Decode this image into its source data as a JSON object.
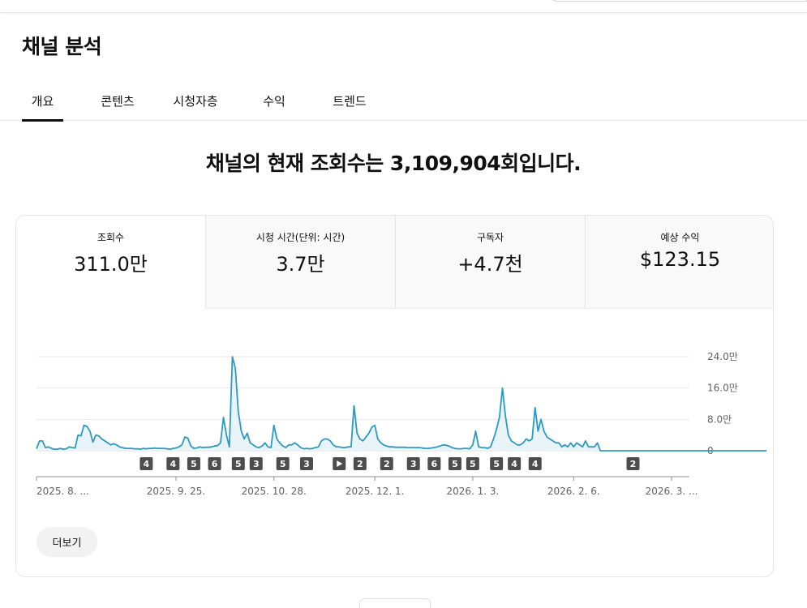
{
  "page": {
    "title": "채널 분석",
    "headline": "채널의 현재 조회수는 3,109,904회입니다.",
    "more_label": "더보기"
  },
  "tabs": [
    {
      "label": "개요",
      "active": true
    },
    {
      "label": "콘텐츠"
    },
    {
      "label": "시청자층"
    },
    {
      "label": "수익"
    },
    {
      "label": "트렌드"
    }
  ],
  "metrics": [
    {
      "label": "조회수",
      "value": "311.0만",
      "active": true
    },
    {
      "label": "시청 시간(단위: 시간)",
      "value": "3.7만"
    },
    {
      "label": "구독자",
      "value": "+4.7천"
    },
    {
      "label": "예상 수익",
      "value": "$123.15"
    }
  ],
  "colors": {
    "accent": "#2e9abf",
    "area_fill": "#e8f4f8",
    "marker_bg": "#4d4d4d"
  },
  "chart_data": {
    "type": "area",
    "series_unit": "views (만)",
    "ylim": [
      0,
      24
    ],
    "y_ticks": [
      {
        "value": 24,
        "label": "24.0만"
      },
      {
        "value": 16,
        "label": "16.0만"
      },
      {
        "value": 8,
        "label": "8.0만"
      },
      {
        "value": 0,
        "label": "0"
      }
    ],
    "x_tick_labels": [
      "2025. 8. ...",
      "2025. 9. 25.",
      "2025. 10. 28.",
      "2025. 12. 1.",
      "2026. 1. 3.",
      "2026. 2. 6.",
      "2026. 3. ..."
    ],
    "x_tick_days": [
      0,
      47,
      80,
      114,
      147,
      181,
      214
    ],
    "day_range": [
      0,
      220
    ],
    "values": [
      0.5,
      2.5,
      2.5,
      0.8,
      1.0,
      0.6,
      0.4,
      0.4,
      0.6,
      0.4,
      0.5,
      1.0,
      0.8,
      0.7,
      4.0,
      3.8,
      6.5,
      6.2,
      5.0,
      2.2,
      4.0,
      3.8,
      3.0,
      2.5,
      2.0,
      1.5,
      1.8,
      1.5,
      1.0,
      0.8,
      0.6,
      0.6,
      0.6,
      0.5,
      0.5,
      0.4,
      0.6,
      0.5,
      0.6,
      0.6,
      0.7,
      0.6,
      0.6,
      0.6,
      0.5,
      0.4,
      0.6,
      0.7,
      1.0,
      1.5,
      3.5,
      3.2,
      1.2,
      0.6,
      0.7,
      1.0,
      0.8,
      0.9,
      0.9,
      1.0,
      1.2,
      1.3,
      2.0,
      8.5,
      4.0,
      1.0,
      24.0,
      21.0,
      10.0,
      5.0,
      3.0,
      4.5,
      2.0,
      1.5,
      1.0,
      0.8,
      1.2,
      2.0,
      1.0,
      0.8,
      6.5,
      3.0,
      2.0,
      1.2,
      0.8,
      1.5,
      1.5,
      2.0,
      1.5,
      0.8,
      0.5,
      0.6,
      0.5,
      0.6,
      0.8,
      1.0,
      2.5,
      3.0,
      3.0,
      2.5,
      1.5,
      1.0,
      1.0,
      0.8,
      0.8,
      1.0,
      1.0,
      11.5,
      4.5,
      3.0,
      2.5,
      3.5,
      4.5,
      6.0,
      6.5,
      3.0,
      2.0,
      1.5,
      1.2,
      1.0,
      1.0,
      0.9,
      0.9,
      0.9,
      0.9,
      0.8,
      0.8,
      0.8,
      0.8,
      0.8,
      0.7,
      0.6,
      0.6,
      0.7,
      0.8,
      1.0,
      1.2,
      1.5,
      1.4,
      1.2,
      0.8,
      0.6,
      0.5,
      0.5,
      0.6,
      0.6,
      0.5,
      1.5,
      5.0,
      1.0,
      0.8,
      0.8,
      0.6,
      1.0,
      3.0,
      5.5,
      8.5,
      16.0,
      9.0,
      4.0,
      2.5,
      2.0,
      1.5,
      1.5,
      2.0,
      3.0,
      2.5,
      3.0,
      11.0,
      5.0,
      8.0,
      5.0,
      3.5,
      3.0,
      2.5,
      2.0,
      2.0,
      1.0,
      1.5,
      1.0,
      2.0,
      1.0,
      2.0,
      1.5,
      1.0,
      2.5,
      1.0,
      1.0,
      1.0,
      2.0,
      0,
      0,
      0,
      0,
      0,
      0,
      0,
      0,
      0,
      0,
      0,
      0,
      0,
      0,
      0,
      0,
      0,
      0,
      0,
      0,
      0,
      0,
      0,
      0,
      0,
      0,
      0,
      0,
      0,
      0,
      0,
      0,
      0,
      0,
      0,
      0,
      0,
      0,
      0,
      0,
      0,
      0,
      0,
      0,
      0,
      0,
      0,
      0,
      0,
      0,
      0,
      0,
      0,
      0,
      0,
      0,
      0
    ]
  },
  "markers": [
    {
      "label": "4",
      "day": 37
    },
    {
      "label": "4",
      "day": 46
    },
    {
      "label": "5",
      "day": 53
    },
    {
      "label": "6",
      "day": 60
    },
    {
      "label": "5",
      "day": 68
    },
    {
      "label": "3",
      "day": 74
    },
    {
      "label": "5",
      "day": 83
    },
    {
      "label": "3",
      "day": 91
    },
    {
      "label": "",
      "icon": "play-icon",
      "day": 102
    },
    {
      "label": "2",
      "day": 109
    },
    {
      "label": "2",
      "day": 118
    },
    {
      "label": "3",
      "day": 127
    },
    {
      "label": "6",
      "day": 134
    },
    {
      "label": "5",
      "day": 141
    },
    {
      "label": "5",
      "day": 147
    },
    {
      "label": "5",
      "day": 155
    },
    {
      "label": "4",
      "day": 161
    },
    {
      "label": "4",
      "day": 168
    },
    {
      "label": "2",
      "day": 201
    }
  ]
}
